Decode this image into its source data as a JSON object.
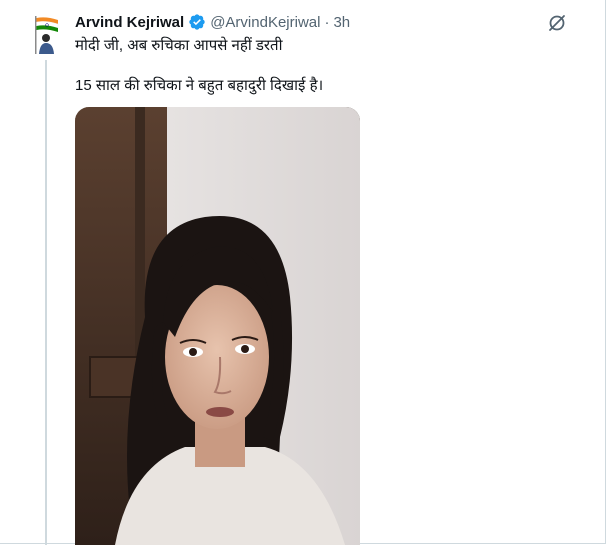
{
  "tweet": {
    "author_name": "Arvind Kejriwal",
    "author_handle": "@ArvindKejriwal",
    "separator": "·",
    "time": "3h",
    "verified_icon": "verified-badge-icon",
    "avatar_icon": "india-flag-avatar",
    "more_icon": "slash-circle-icon",
    "text_line_1": "मोदी जी, अब रुचिका आपसे नहीं डरती",
    "text_line_2": "15 साल की रुचिका ने बहुत बहादुरी दिखाई है।",
    "media_type": "video-thumbnail"
  },
  "colors": {
    "accent": "#1d9bf0",
    "text_primary": "#0f1419",
    "text_secondary": "#536471",
    "border": "#cfd9de"
  }
}
